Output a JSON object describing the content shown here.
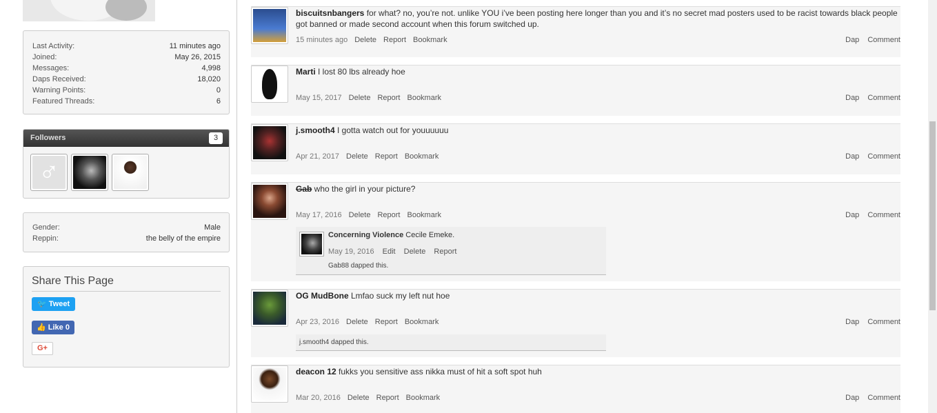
{
  "sidebar": {
    "stats": [
      {
        "label": "Last Activity:",
        "value": "11 minutes ago"
      },
      {
        "label": "Joined:",
        "value": "May 26, 2015"
      },
      {
        "label": "Messages:",
        "value": "4,998"
      },
      {
        "label": "Daps Received:",
        "value": "18,020"
      },
      {
        "label": "Warning Points:",
        "value": "0"
      },
      {
        "label": "Featured Threads:",
        "value": "6"
      }
    ],
    "followers": {
      "title": "Followers",
      "count": "3"
    },
    "profile": [
      {
        "label": "Gender:",
        "value": "Male"
      },
      {
        "label": "Reppin:",
        "value": "the belly of the empire"
      }
    ],
    "share": {
      "title": "Share This Page",
      "tweet": "Tweet",
      "like": "Like",
      "like_count": "0",
      "gplus": "G+"
    }
  },
  "posts": [
    {
      "author": "biscuitsnbangers",
      "text": " for what? no, you’re not. unlike YOU i’ve been posting here longer than you and it’s no secret mad posters used to be racist towards black people got banned or made second account when this forum switched up.",
      "date": "15 minutes ago",
      "actions": [
        "Delete",
        "Report",
        "Bookmark"
      ]
    },
    {
      "author": "Marti",
      "text": " I lost 80 lbs already hoe",
      "date": "May 15, 2017",
      "actions": [
        "Delete",
        "Report",
        "Bookmark"
      ]
    },
    {
      "author": "j.smooth4",
      "text": " I gotta watch out for youuuuuu",
      "date": "Apr 21, 2017",
      "actions": [
        "Delete",
        "Report",
        "Bookmark"
      ]
    },
    {
      "author": "Gab",
      "text": " who the girl in your picture?",
      "date": "May 17, 2016",
      "actions": [
        "Delete",
        "Report",
        "Bookmark"
      ],
      "reply": {
        "author": "Concerning Violence",
        "text": " Cecile Emeke.",
        "date": "May 19, 2016",
        "actions": [
          "Edit",
          "Delete",
          "Report"
        ],
        "dapped": "Gab88 dapped this."
      }
    },
    {
      "author": "OG MudBone",
      "text": " Lmfao suck my left nut hoe",
      "date": "Apr 23, 2016",
      "actions": [
        "Delete",
        "Report",
        "Bookmark"
      ],
      "dapped": "j.smooth4 dapped this."
    },
    {
      "author": "deacon 12",
      "text": " fukks you sensitive ass nikka must of hit a soft spot huh",
      "date": "Mar 20, 2016",
      "actions": [
        "Delete",
        "Report",
        "Bookmark"
      ]
    }
  ],
  "post_right_actions": [
    "Dap",
    "Comment"
  ],
  "icons": {
    "bird": "twitter-bird-icon",
    "thumb": "thumbs-up-icon",
    "male": "male-symbol-icon"
  }
}
